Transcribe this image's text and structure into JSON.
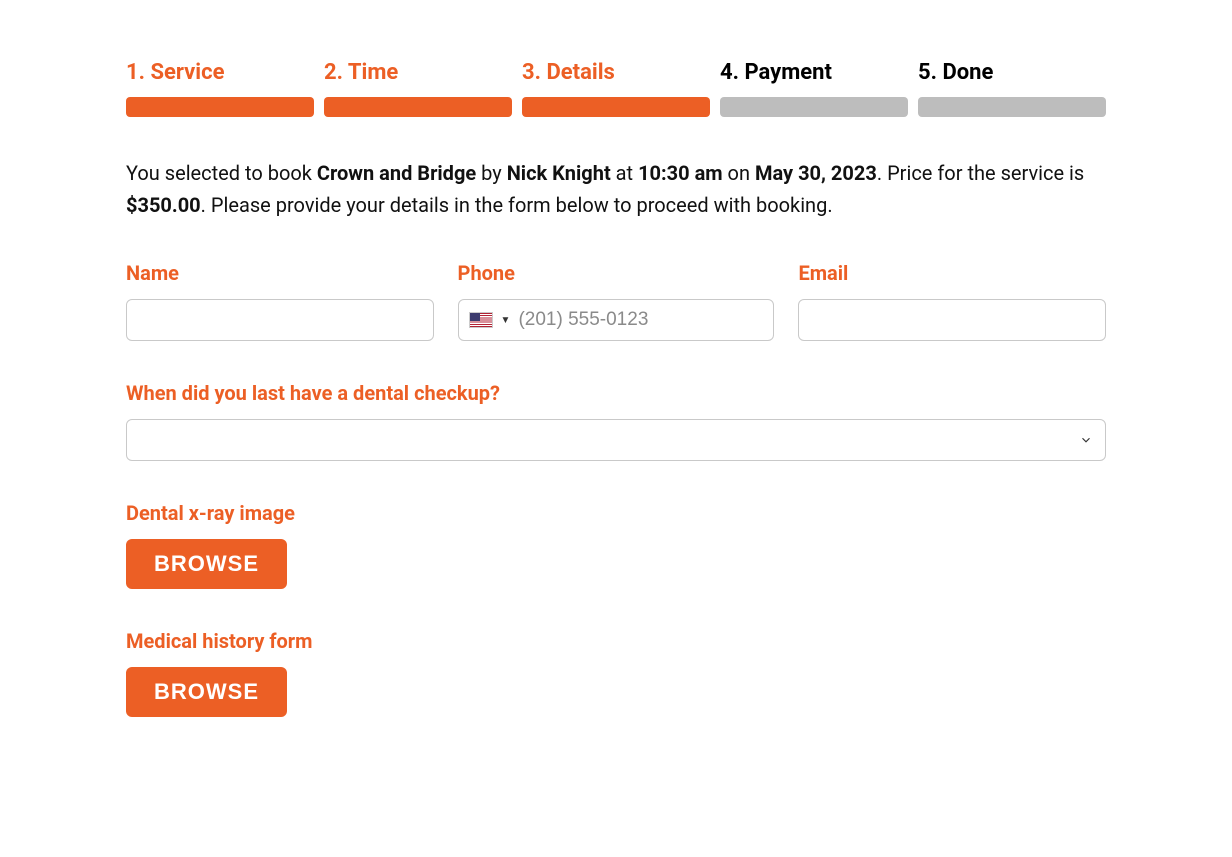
{
  "steps": [
    {
      "label": "1. Service",
      "active": true
    },
    {
      "label": "2. Time",
      "active": true
    },
    {
      "label": "3. Details",
      "active": true
    },
    {
      "label": "4. Payment",
      "active": false
    },
    {
      "label": "5. Done",
      "active": false
    }
  ],
  "summary": {
    "prefix": "You selected to book ",
    "service": "Crown and Bridge",
    "by_text": " by ",
    "provider": "Nick Knight",
    "at_text": " at ",
    "time": "10:30 am",
    "on_text": " on ",
    "date": "May 30, 2023",
    "price_prefix": ". Price for the service is ",
    "price": "$350.00",
    "suffix": ". Please provide your details in the form below to proceed with booking."
  },
  "fields": {
    "name_label": "Name",
    "phone_label": "Phone",
    "phone_placeholder": "(201) 555-0123",
    "email_label": "Email",
    "checkup_label": "When did you last have a dental checkup?",
    "xray_label": "Dental x-ray image",
    "medical_label": "Medical history form",
    "browse_label": "BROWSE"
  },
  "colors": {
    "accent": "#ec5f25"
  }
}
